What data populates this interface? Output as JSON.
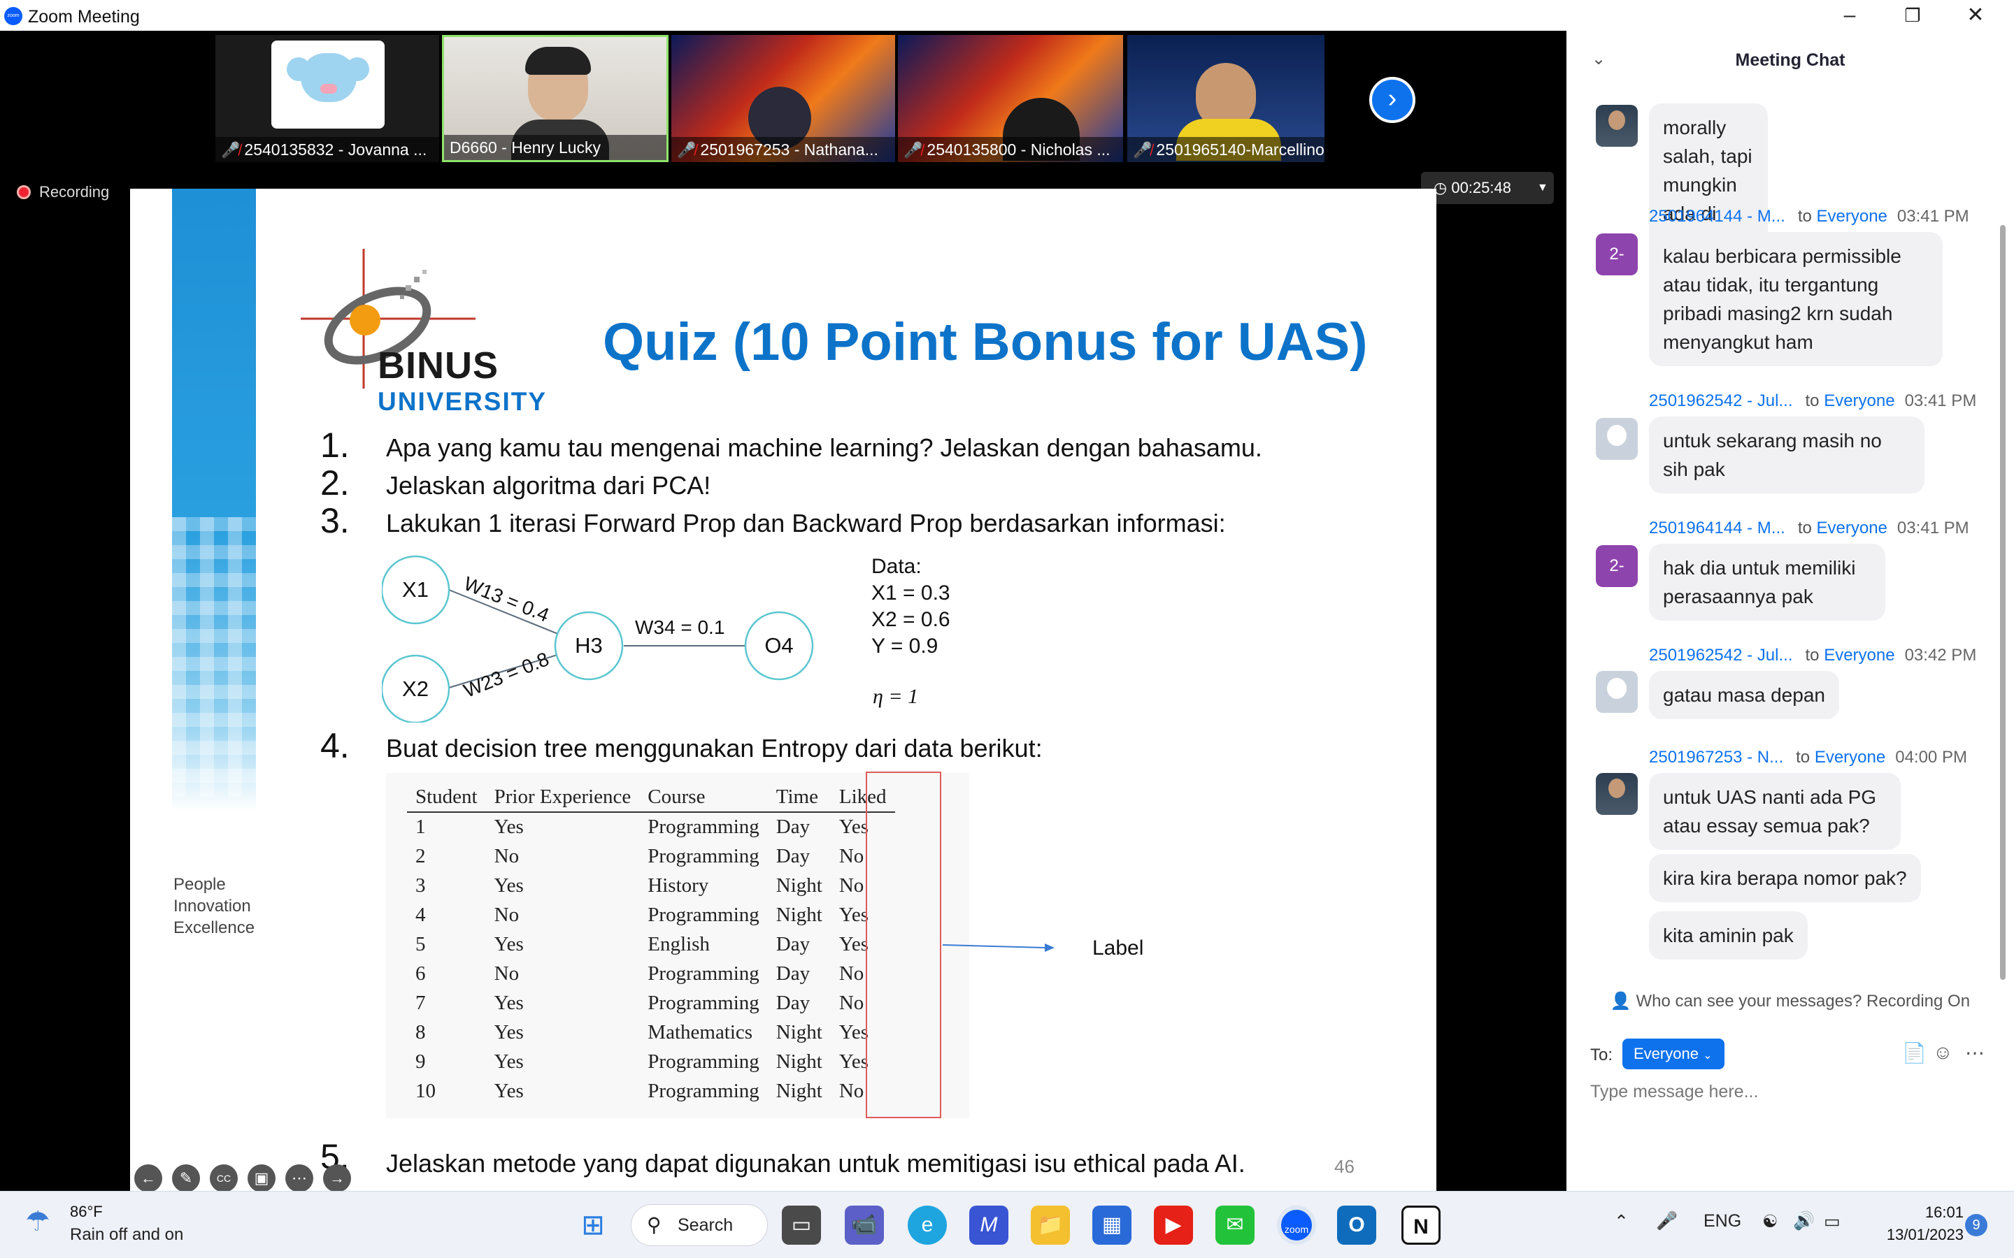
{
  "window": {
    "title": "Zoom Meeting"
  },
  "participants": [
    {
      "name": "2540135832 - Jovanna ...",
      "muted": true
    },
    {
      "name": "D6660 - Henry Lucky",
      "muted": false,
      "active_speaker": true
    },
    {
      "name": "2501967253 - Nathana...",
      "muted": true
    },
    {
      "name": "2540135800 - Nicholas ...",
      "muted": true
    },
    {
      "name": "2501965140-Marcellino...",
      "muted": true
    }
  ],
  "recording": {
    "label": "Recording",
    "timer": "00:25:48"
  },
  "slide": {
    "title": "Quiz (10 Point Bonus for UAS)",
    "logo": {
      "word": "BINUS",
      "sub": "UNIVERSITY"
    },
    "tagline": [
      "People",
      "Innovation",
      "Excellence"
    ],
    "questions": [
      {
        "num": "1.",
        "text": "Apa yang kamu tau mengenai machine learning? Jelaskan dengan bahasamu."
      },
      {
        "num": "2.",
        "text": "Jelaskan algoritma dari PCA!"
      },
      {
        "num": "3.",
        "text": "Lakukan 1 iterasi Forward Prop dan Backward Prop berdasarkan informasi:"
      },
      {
        "num": "4.",
        "text": "Buat decision tree menggunakan Entropy dari data berikut:"
      },
      {
        "num": "5.",
        "text": "Jelaskan metode yang dapat digunakan untuk memitigasi isu ethical pada AI."
      }
    ],
    "network": {
      "nodes": [
        "X1",
        "X2",
        "H3",
        "O4"
      ],
      "weights": [
        "W13 = 0.4",
        "W23 = 0.8",
        "W34 = 0.1"
      ]
    },
    "data_block": [
      "Data:",
      "X1 = 0.3",
      "X2 = 0.6",
      "Y = 0.9"
    ],
    "eta": "η = 1",
    "table": {
      "headers": [
        "Student",
        "Prior Experience",
        "Course",
        "Time",
        "Liked"
      ],
      "rows": [
        [
          "1",
          "Yes",
          "Programming",
          "Day",
          "Yes"
        ],
        [
          "2",
          "No",
          "Programming",
          "Day",
          "No"
        ],
        [
          "3",
          "Yes",
          "History",
          "Night",
          "No"
        ],
        [
          "4",
          "No",
          "Programming",
          "Night",
          "Yes"
        ],
        [
          "5",
          "Yes",
          "English",
          "Day",
          "Yes"
        ],
        [
          "6",
          "No",
          "Programming",
          "Day",
          "No"
        ],
        [
          "7",
          "Yes",
          "Programming",
          "Day",
          "No"
        ],
        [
          "8",
          "Yes",
          "Mathematics",
          "Night",
          "Yes"
        ],
        [
          "9",
          "Yes",
          "Programming",
          "Night",
          "Yes"
        ],
        [
          "10",
          "Yes",
          "Programming",
          "Night",
          "No"
        ]
      ]
    },
    "label_text": "Label",
    "page_number": "46"
  },
  "chat": {
    "header": "Meeting Chat",
    "messages": [
      {
        "sender": "",
        "to": "",
        "recipient": "",
        "time": "",
        "avatar": "photo",
        "avatar_text": "",
        "bubbles": [
          "morally salah, tapi mungkin ada di dunia ini pak"
        ]
      },
      {
        "sender": "2501964144 - M...",
        "to": "to",
        "recipient": "Everyone",
        "time": "03:41 PM",
        "avatar": "letter",
        "avatar_text": "2-",
        "bubbles": [
          "kalau berbicara permissible atau tidak, itu tergantung pribadi masing2 krn sudah menyangkut ham"
        ]
      },
      {
        "sender": "2501962542 - Jul...",
        "to": "to",
        "recipient": "Everyone",
        "time": "03:41 PM",
        "avatar": "default",
        "avatar_text": "",
        "bubbles": [
          "untuk sekarang masih no sih pak"
        ]
      },
      {
        "sender": "2501964144 - M...",
        "to": "to",
        "recipient": "Everyone",
        "time": "03:41 PM",
        "avatar": "letter",
        "avatar_text": "2-",
        "bubbles": [
          "hak dia untuk memiliki perasaannya pak"
        ]
      },
      {
        "sender": "2501962542 - Jul...",
        "to": "to",
        "recipient": "Everyone",
        "time": "03:42 PM",
        "avatar": "default",
        "avatar_text": "",
        "bubbles": [
          "gatau masa depan"
        ]
      },
      {
        "sender": "2501967253 - N...",
        "to": "to",
        "recipient": "Everyone",
        "time": "04:00 PM",
        "avatar": "photo",
        "avatar_text": "",
        "bubbles": [
          "untuk UAS nanti ada PG atau essay semua pak?",
          "kira kira berapa nomor pak?",
          "kita aminin pak"
        ]
      }
    ],
    "notice": "Who can see your messages? Recording On",
    "to_label": "To:",
    "to_value": "Everyone",
    "input_placeholder": "Type message here..."
  },
  "taskbar": {
    "weather": {
      "temp": "86°F",
      "desc": "Rain off and on"
    },
    "search_label": "Search",
    "language": "ENG",
    "time": "16:01",
    "date": "13/01/2023",
    "notification_count": "9"
  },
  "colors": {
    "zoom_blue": "#0e72ed",
    "slide_title_blue": "#0d73c9",
    "liked_border": "#e05a5a"
  }
}
